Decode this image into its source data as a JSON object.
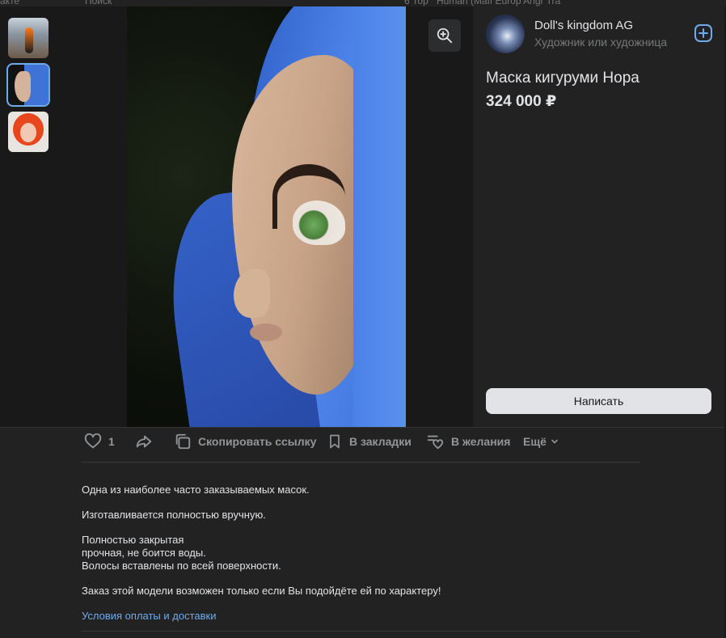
{
  "background_strip": {
    "site_fragment": "акте",
    "search_fragment": "Поиск",
    "tab1_fragment": "6 Тор",
    "tab2_fragment": "Human (Maff Europ Angr Tra"
  },
  "author": {
    "name": "Doll's kingdom AG",
    "role": "Художник или художница"
  },
  "product": {
    "title": "Маска кигуруми Нора",
    "price": "324 000 ₽"
  },
  "buttons": {
    "write": "Написать"
  },
  "actions": {
    "likes_count": "1",
    "copy_link": "Скопировать ссылку",
    "bookmarks": "В закладки",
    "wishlist": "В желания",
    "more": "Ещё"
  },
  "description": {
    "line1": "Одна из наиболее часто заказываемых масок.",
    "line2": "Изготавливается полностью вручную.",
    "line3": "Полностью закрытая",
    "line4": "прочная, не боится воды.",
    "line5": "Волосы вставлены по всей поверхности.",
    "line6": "Заказ этой модели возможен только если Вы подойдёте ей по характеру!",
    "terms_link": "Условия оплаты и доставки"
  },
  "colors": {
    "accent": "#71aaeb",
    "panel": "#222222",
    "text": "#e1e3e6",
    "secondary": "#939699"
  }
}
